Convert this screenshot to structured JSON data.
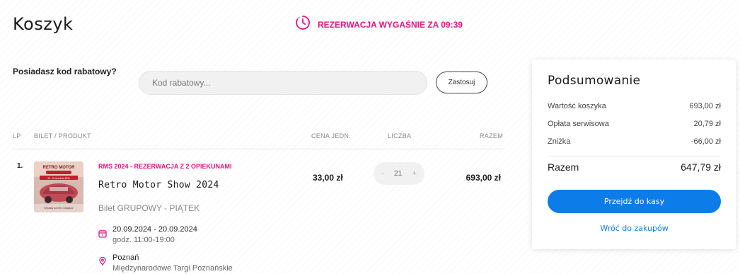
{
  "page": {
    "title": "Koszyk"
  },
  "timer": {
    "text": "REZERWACJA WYGAŚNIE ZA 09:39",
    "icon": "clock-icon",
    "color": "#e3167f"
  },
  "promo": {
    "label": "Posiadasz kod rabatowy?",
    "placeholder": "Kod rabatowy...",
    "value": "",
    "apply_label": "Zastosuj"
  },
  "table": {
    "headers": {
      "lp": "LP",
      "product": "BILET / PRODUKT",
      "unit_price": "CENA JEDN.",
      "quantity": "LICZBA",
      "total": "RAZEM"
    },
    "rows": [
      {
        "lp": "1.",
        "subtitle": "RMS 2024 - REZERWACJA Z 2 OPIEKUNAMI",
        "name": "Retro Motor Show 2024",
        "ticket_type": "Bilet GRUPOWY - PIĄTEK",
        "date_range": "20.09.2024 - 20.09.2024",
        "hours": "godz. 11:00-19:00",
        "city": "Poznań",
        "venue": "Międzynarodowe Targi Poznańskie",
        "unit_price": "33,00 zł",
        "quantity": "21",
        "total": "693,00 zł",
        "thumbnail": {
          "logo_text": "RETRO MOTOR",
          "date_band": "20 - 22 września 2024",
          "tagline": "Wystawy aut retro i klasyków"
        }
      }
    ]
  },
  "stepper": {
    "minus": "-",
    "plus": "+"
  },
  "summary": {
    "title": "Podsumowanie",
    "lines": [
      {
        "label": "Wartość koszyka",
        "value": "693,00 zł"
      },
      {
        "label": "Opłata serwisowa",
        "value": "20,79 zł"
      },
      {
        "label": "Zniżka",
        "value": "-66,00 zł"
      }
    ],
    "total_label": "Razem",
    "total_value": "647,79 zł",
    "checkout_label": "Przejdź do kasy",
    "back_label": "Wróć do zakupów"
  },
  "colors": {
    "accent": "#e3167f",
    "primary": "#0c7de8"
  }
}
